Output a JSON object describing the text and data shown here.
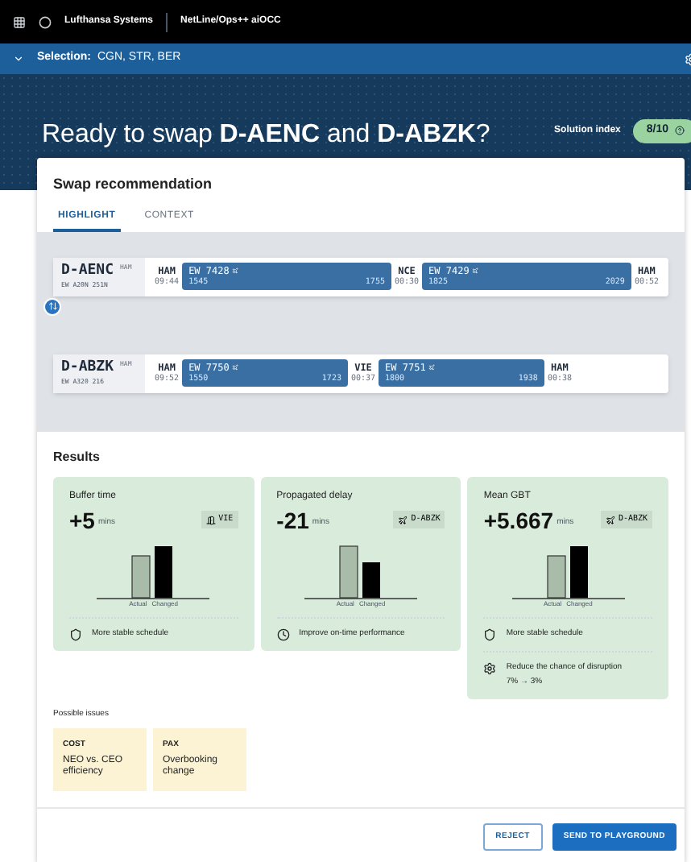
{
  "topbar": {
    "company": "Lufthansa Systems",
    "product": "NetLine/Ops++ aiOCC"
  },
  "selection": {
    "label": "Selection:",
    "value": "CGN, STR, BER"
  },
  "hero": {
    "title": "Ready to swap **D-AENC** and **D-ABZK**?",
    "index_label": "Solution index",
    "index_value": "8/10"
  },
  "card": {
    "title": "Swap recommendation",
    "tabs": [
      {
        "label": "HIGHLIGHT",
        "selected": true
      },
      {
        "label": "CONTEXT",
        "selected": false
      }
    ],
    "aircraft": [
      {
        "tail": "D-AENC",
        "base": "HAM",
        "type": "EW A20N 251N",
        "segments": [
          {
            "kind": "station",
            "code": "HAM",
            "time": "09:44"
          },
          {
            "kind": "flight",
            "number": "EW 7428",
            "dep": "1545",
            "arr": "1755"
          },
          {
            "kind": "station",
            "code": "NCE",
            "time": "00:30"
          },
          {
            "kind": "flight",
            "number": "EW 7429",
            "dep": "1825",
            "arr": "2029"
          },
          {
            "kind": "station",
            "code": "HAM",
            "time": "00:52"
          }
        ]
      },
      {
        "tail": "D-ABZK",
        "base": "HAM",
        "type": "EW A320 216",
        "segments": [
          {
            "kind": "station",
            "code": "HAM",
            "time": "09:52"
          },
          {
            "kind": "flight",
            "number": "EW 7750",
            "dep": "1550",
            "arr": "1723"
          },
          {
            "kind": "station",
            "code": "VIE",
            "time": "00:37"
          },
          {
            "kind": "flight",
            "number": "EW 7751",
            "dep": "1800",
            "arr": "1938"
          },
          {
            "kind": "station",
            "code": "HAM",
            "time": "00:38"
          }
        ]
      }
    ],
    "results_title": "Results",
    "results": [
      {
        "title": "Buffer time",
        "value": "+5",
        "unit": "mins",
        "tag": {
          "kind": "gate",
          "label": "VIE"
        },
        "actual_label": "Actual",
        "changed_label": "Changed",
        "benefits": [
          {
            "kind": "stability",
            "text": "More stable schedule"
          }
        ]
      },
      {
        "title": "Propagated delay",
        "value": "-21",
        "unit": "mins",
        "tag": {
          "kind": "aircraft",
          "label": "D-ABZK"
        },
        "actual_label": "Actual",
        "changed_label": "Changed",
        "benefits": [
          {
            "kind": "punctuality",
            "text": "Improve on-time performance"
          }
        ]
      },
      {
        "title": "Mean GBT",
        "value": "+5.667",
        "unit": "mins",
        "tag": {
          "kind": "aircraft",
          "label": "D-ABZK"
        },
        "actual_label": "Actual",
        "changed_label": "Changed",
        "benefits": [
          {
            "kind": "stability",
            "text": "More stable schedule"
          },
          {
            "kind": "disruption",
            "text": "Reduce the chance of disruption",
            "detail": "7% → 3%"
          }
        ]
      }
    ],
    "issues_title": "Possible issues",
    "issues": [
      {
        "category": "COST",
        "text": "NEO vs. CEO efficiency"
      },
      {
        "category": "PAX",
        "text": "Overbooking change"
      }
    ],
    "buttons": [
      {
        "label": "REJECT",
        "kind": "outline"
      },
      {
        "label": "SEND TO PLAYGROUND",
        "kind": "primary"
      }
    ]
  }
}
